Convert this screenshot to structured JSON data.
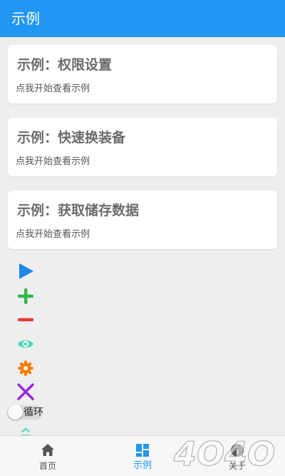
{
  "appbar": {
    "title": "示例"
  },
  "cards": [
    {
      "title": "示例：权限设置",
      "subtitle": "点我开始查看示例"
    },
    {
      "title": "示例：快速换装备",
      "subtitle": "点我开始查看示例"
    },
    {
      "title": "示例：获取储存数据",
      "subtitle": "点我开始查看示例"
    }
  ],
  "tools": [
    {
      "icon": "play-icon",
      "color": "#1e88e5"
    },
    {
      "icon": "plus-icon",
      "color": "#2fb84a"
    },
    {
      "icon": "minus-icon",
      "color": "#e53935"
    },
    {
      "icon": "eye-icon",
      "color": "#4fd6b9"
    },
    {
      "icon": "gear-icon",
      "color": "#f57c00"
    },
    {
      "icon": "close-icon",
      "color": "#9c27d8"
    }
  ],
  "toggle": {
    "label": "循环",
    "on": false
  },
  "bottom_nav": {
    "items": [
      {
        "label": "首页",
        "icon": "home-icon",
        "active": false
      },
      {
        "label": "示例",
        "icon": "grid-icon",
        "active": true
      },
      {
        "label": "关于",
        "icon": "info-icon",
        "active": false
      }
    ]
  },
  "watermark": {
    "text": "4O4O"
  },
  "colors": {
    "primary": "#2196f3",
    "background": "#eeeeee",
    "card": "#ffffff"
  }
}
